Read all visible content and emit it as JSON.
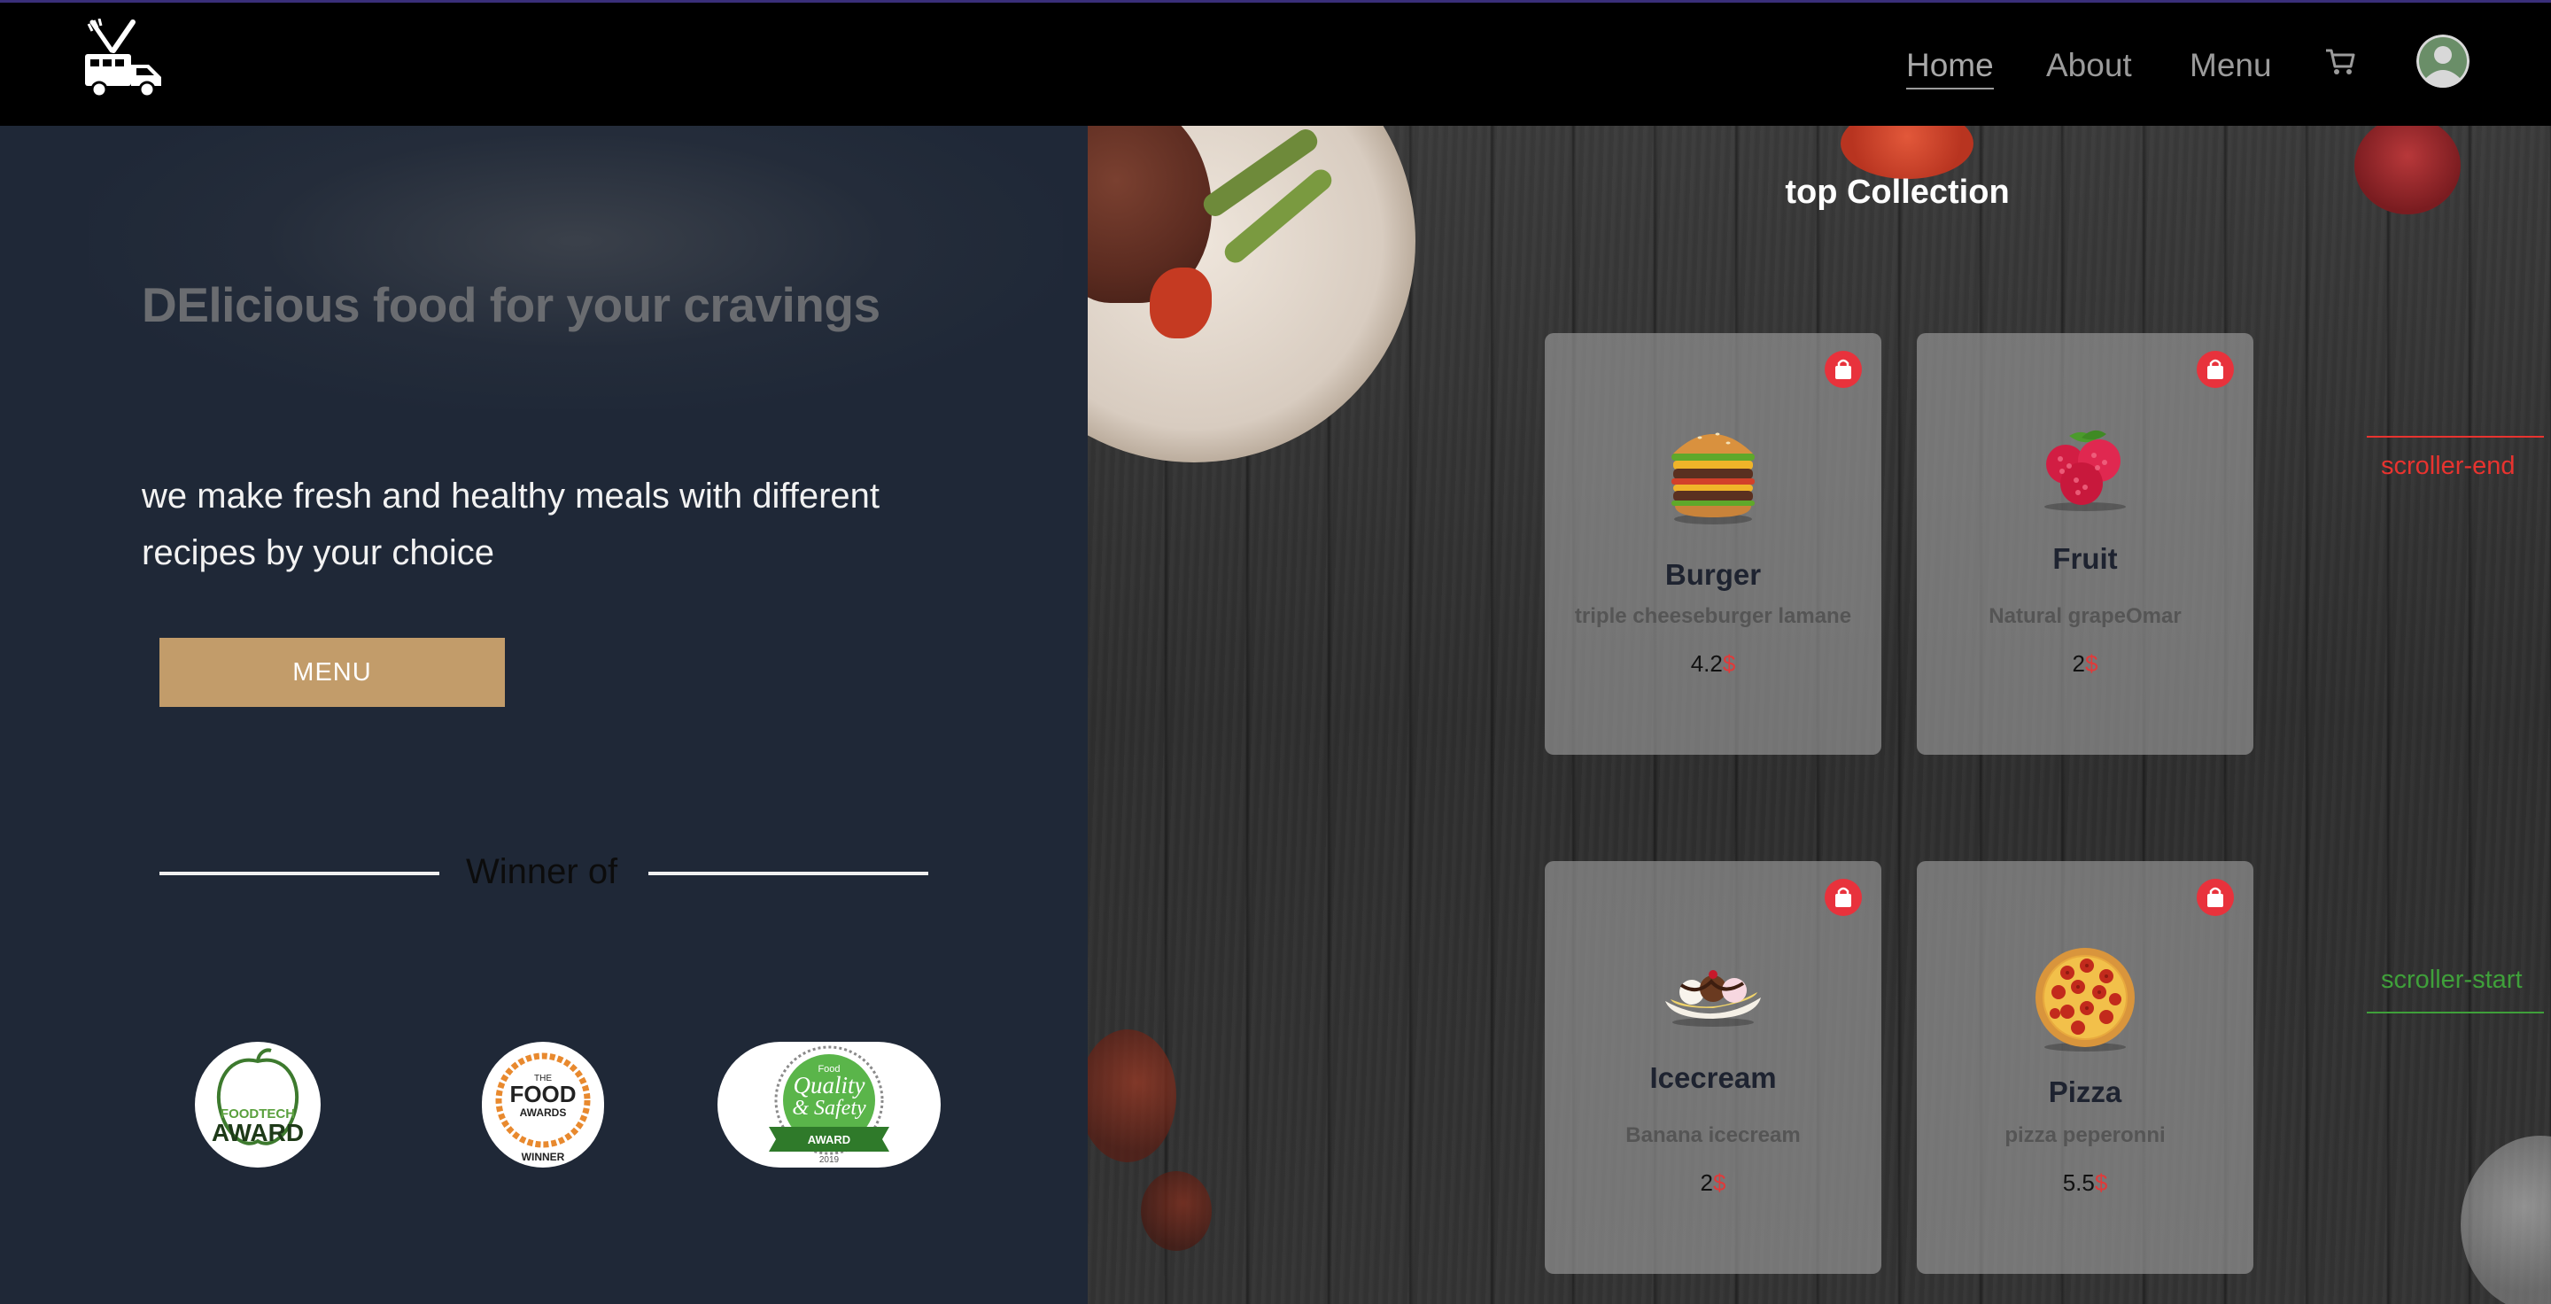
{
  "nav": {
    "links": [
      {
        "label": "Home"
      },
      {
        "label": "About"
      },
      {
        "label": "Menu"
      }
    ],
    "icons": [
      "food-truck-logo-icon",
      "cart-icon",
      "avatar-icon"
    ]
  },
  "hero": {
    "title": "DElicious food for your cravings",
    "subtitle": "we make fresh and healthy meals with different recipes by your choice",
    "menu_button": "MENU",
    "winner_label": "Winner of",
    "awards": [
      {
        "name": "foodtech-award",
        "line1": "FOODTECH",
        "line2": "AWARD"
      },
      {
        "name": "food-awards-winner",
        "line1": "THE",
        "line2": "FOOD",
        "line3": "AWARDS",
        "line4": "WINNER"
      },
      {
        "name": "food-quality-safety-award",
        "line1": "Food",
        "line2": "Quality",
        "line3": "& Safety",
        "line4": "AWARD",
        "line5": "2019"
      }
    ]
  },
  "collection": {
    "title": "top Collection",
    "currency": "$",
    "cards": [
      {
        "name": "Burger",
        "desc": "triple cheeseburger lamane",
        "price": "4.2"
      },
      {
        "name": "Fruit",
        "desc": "Natural grapeOmar",
        "price": "2"
      },
      {
        "name": "Icecream",
        "desc": "Banana icecream",
        "price": "2"
      },
      {
        "name": "Pizza",
        "desc": "pizza peperonni",
        "price": "5.5"
      }
    ]
  },
  "scroller": {
    "end_label": "scroller-end",
    "start_label": "scroller-start",
    "end_color": "#e8332f",
    "start_color": "#3fa03a"
  },
  "colors": {
    "nav_bg": "#000000",
    "left_bg": "#1f2837",
    "menu_button": "#c29c6a",
    "bag_icon": "#e8323c"
  }
}
